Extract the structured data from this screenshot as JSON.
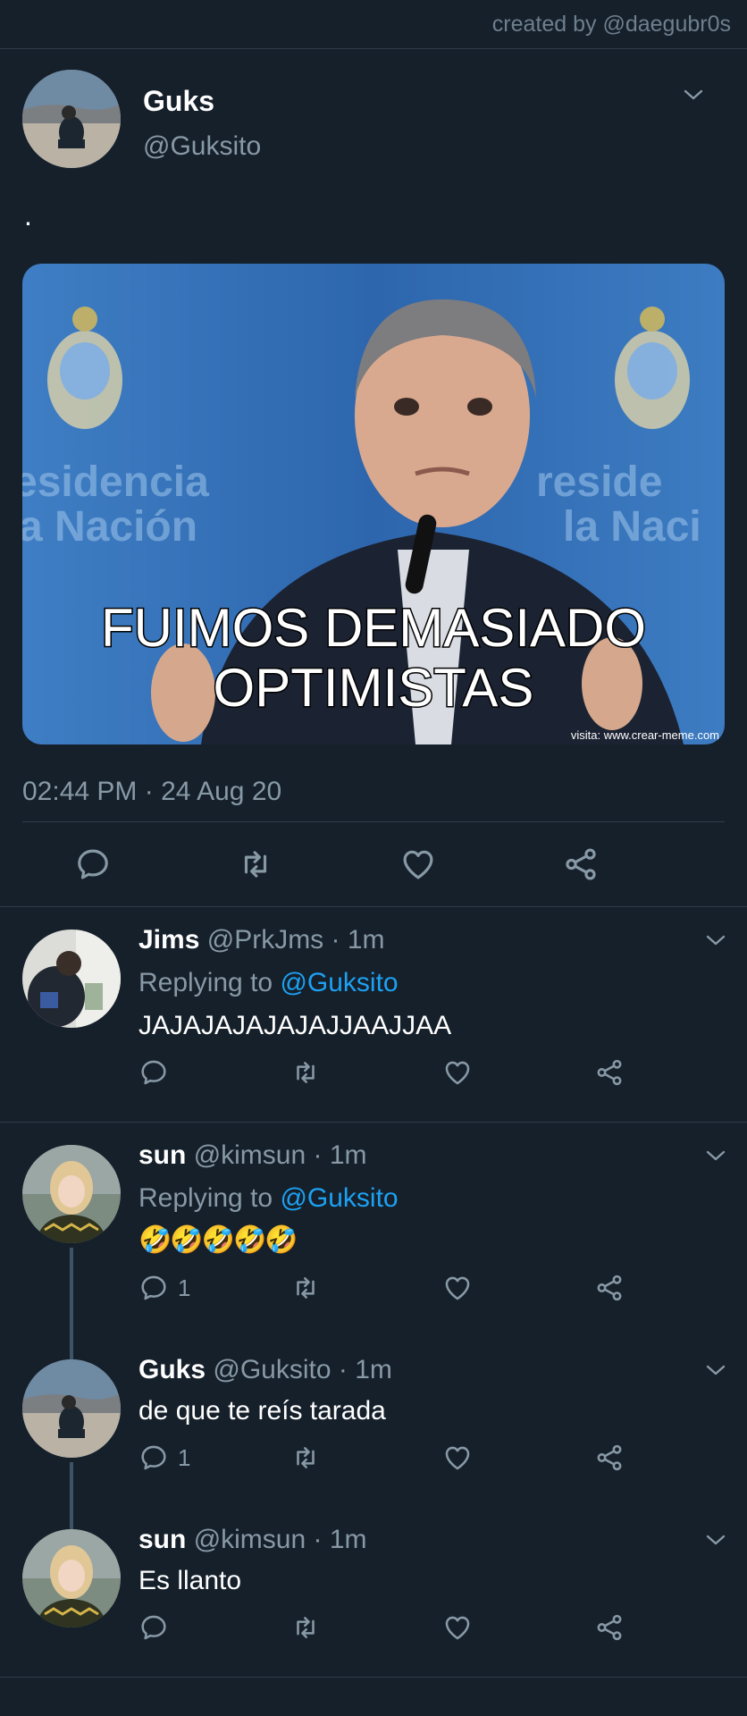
{
  "credit": "created by @daegubr0s",
  "main_tweet": {
    "name": "Guks",
    "handle": "@Guksito",
    "text": ".",
    "media_caption_line1": "FUIMOS DEMASIADO",
    "media_caption_line2": "OPTIMISTAS",
    "media_bg_left": "esidencia",
    "media_bg_left2": "a Nación",
    "media_bg_right": "reside",
    "media_bg_right2": "la Naci",
    "media_watermark": "visita: www.crear-meme.com",
    "timestamp": "02:44 PM · 24 Aug 20"
  },
  "replies": [
    {
      "name": "Jims",
      "handle": "@PrkJms",
      "time": "· 1m",
      "replying_label": "Replying to",
      "replying_to": "@Guksito",
      "text": "JAJAJAJAJAJAJJAAJJAA",
      "reply_count": ""
    },
    {
      "name": "sun",
      "handle": "@kimsun",
      "time": "· 1m",
      "replying_label": "Replying to",
      "replying_to": "@Guksito",
      "text": "🤣🤣🤣🤣🤣",
      "reply_count": "1"
    },
    {
      "name": "Guks",
      "handle": "@Guksito",
      "time": "· 1m",
      "text": "de que te reís tarada",
      "reply_count": "1"
    },
    {
      "name": "sun",
      "handle": "@kimsun",
      "time": "· 1m",
      "text": "Es llanto",
      "reply_count": ""
    }
  ],
  "icons": {
    "reply": "reply-icon",
    "retweet": "retweet-icon",
    "like": "heart-icon",
    "share": "share-icon",
    "more": "chevron-down-icon"
  },
  "colors": {
    "background": "#15202b",
    "muted": "#8899a6",
    "link": "#1da1f2",
    "divider": "#2f3d4a"
  }
}
